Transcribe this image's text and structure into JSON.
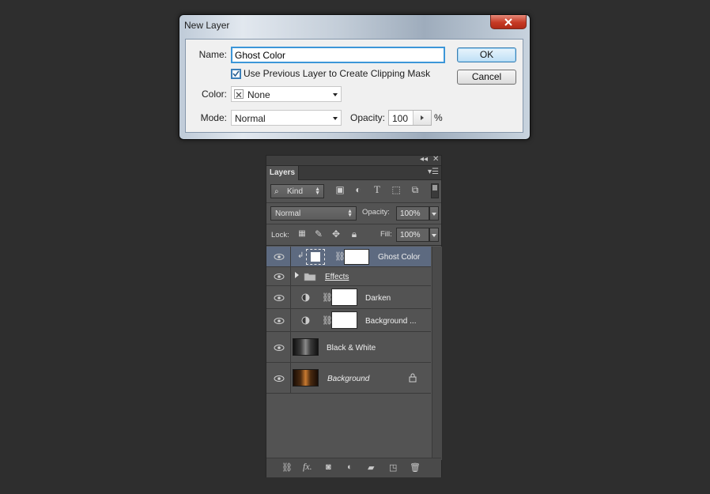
{
  "dialog": {
    "title": "New Layer",
    "name_label": "Name:",
    "name_value": "Ghost Color",
    "clipping_checkbox_checked": true,
    "clipping_label": "Use Previous Layer to Create Clipping Mask",
    "color_label": "Color:",
    "color_value": "None",
    "mode_label": "Mode:",
    "mode_value": "Normal",
    "opacity_label": "Opacity:",
    "opacity_value": "100",
    "opacity_unit": "%",
    "ok_label": "OK",
    "cancel_label": "Cancel"
  },
  "layers_panel": {
    "tab_label": "Layers",
    "filter_kind": "Kind",
    "blend_mode": "Normal",
    "opacity_label": "Opacity:",
    "opacity_value": "100%",
    "lock_label": "Lock:",
    "fill_label": "Fill:",
    "fill_value": "100%",
    "layers": [
      {
        "name": "Ghost Color",
        "type": "clipped-layer",
        "selected": true
      },
      {
        "name": "Effects",
        "type": "group"
      },
      {
        "name": "Darken",
        "type": "adjustment"
      },
      {
        "name": "Background ...",
        "type": "adjustment"
      },
      {
        "name": "Black & White",
        "type": "smart-object"
      },
      {
        "name": "Background",
        "type": "background",
        "locked": true
      }
    ]
  },
  "colors": {
    "app_bg": "#2e2e2e",
    "panel_bg": "#535353",
    "selected_layer": "#5d6a80",
    "ok_button": "#bfe0f6",
    "close_button": "#c63a25"
  }
}
